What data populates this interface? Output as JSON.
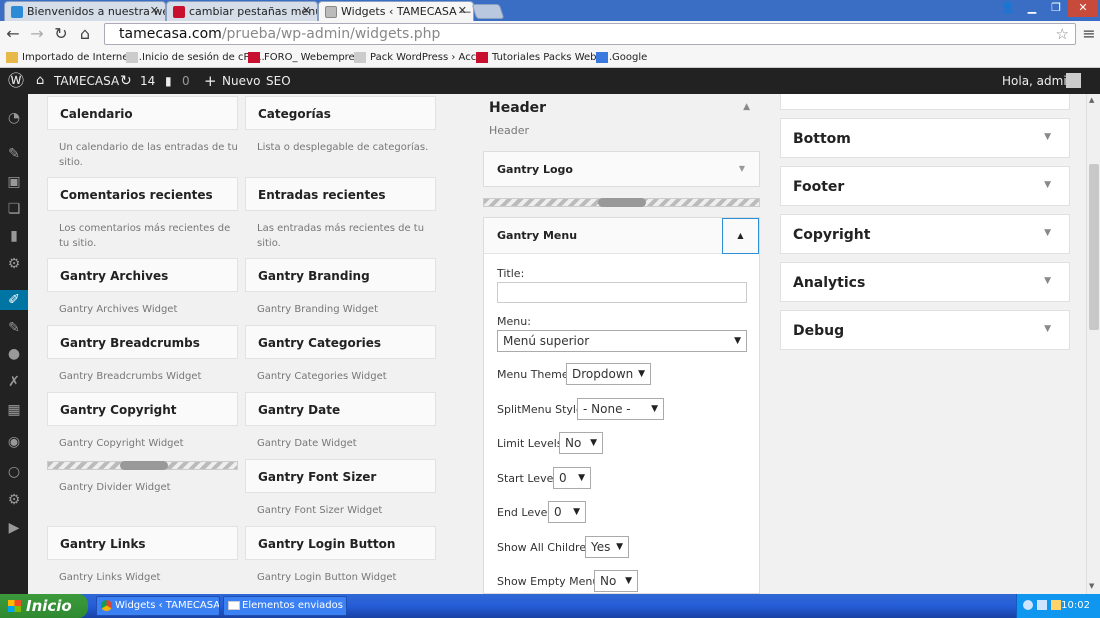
{
  "browser": {
    "tabs": [
      {
        "label": "Bienvenidos a nuestra web -",
        "fav_color": "#2b8bd6"
      },
      {
        "label": "cambiar pestañas menu a la",
        "fav_color": "#c8102e"
      },
      {
        "label": "Widgets ‹ TAMECASA — Wo",
        "fav_color": "#888888"
      }
    ],
    "url_host": "tamecasa.com",
    "url_path": "/prueba/wp-admin/widgets.php",
    "bookmarks": [
      "Importado de Internet...",
      "Inicio de sesión de cPa...",
      "FORO_ Webempresa",
      "Pack WordPress › Acc...",
      "Tutoriales Packs Webe...",
      "Google"
    ]
  },
  "adminbar": {
    "site": "TAMECASA",
    "updates": "14",
    "comments": "0",
    "new": "Nuevo",
    "seo": "SEO",
    "greeting": "Hola, admin"
  },
  "widgets": [
    {
      "title": "Calendario",
      "desc": "Un calendario de las entradas de tu sitio."
    },
    {
      "title": "Categorías",
      "desc": "Lista o desplegable de categorías."
    },
    {
      "title": "Comentarios recientes",
      "desc": "Los comentarios más recientes de tu sitio."
    },
    {
      "title": "Entradas recientes",
      "desc": "Las entradas más recientes de tu sitio."
    },
    {
      "title": "Gantry Archives",
      "desc": "Gantry Archives Widget"
    },
    {
      "title": "Gantry Branding",
      "desc": "Gantry Branding Widget"
    },
    {
      "title": "Gantry Breadcrumbs",
      "desc": "Gantry Breadcrumbs Widget"
    },
    {
      "title": "Gantry Categories",
      "desc": "Gantry Categories Widget"
    },
    {
      "title": "Gantry Copyright",
      "desc": "Gantry Copyright Widget"
    },
    {
      "title": "Gantry Date",
      "desc": "Gantry Date Widget"
    },
    {
      "title": "",
      "desc": "Gantry Divider Widget"
    },
    {
      "title": "Gantry Font Sizer",
      "desc": "Gantry Font Sizer Widget"
    },
    {
      "title": "Gantry Links",
      "desc": "Gantry Links Widget"
    },
    {
      "title": "Gantry Login Button",
      "desc": "Gantry Login Button Widget"
    }
  ],
  "header_area": {
    "title": "Header",
    "subtitle": "Header",
    "logo_widget": "Gantry Logo",
    "menu_widget": "Gantry Menu"
  },
  "menu_form": {
    "title_label": "Title:",
    "title_value": "",
    "menu_label": "Menu:",
    "menu_value": "Menú superior",
    "theme_label": "Menu Theme:",
    "theme_value": "Dropdown",
    "split_label": "SplitMenu Style:",
    "split_value": "- None -",
    "limit_label": "Limit Levels:",
    "limit_value": "No",
    "start_label": "Start Level:",
    "start_value": "0",
    "end_label": "End Level:",
    "end_value": "0",
    "children_label": "Show All Children:",
    "children_value": "Yes",
    "empty_label": "Show Empty Menu:",
    "empty_value": "No"
  },
  "right_areas": [
    "Bottom",
    "Footer",
    "Copyright",
    "Analytics",
    "Debug"
  ],
  "taskbar": {
    "start": "Inicio",
    "task1": "Widgets ‹ TAMECASA...",
    "task2": "Elementos enviados -...",
    "clock": "10:02"
  }
}
